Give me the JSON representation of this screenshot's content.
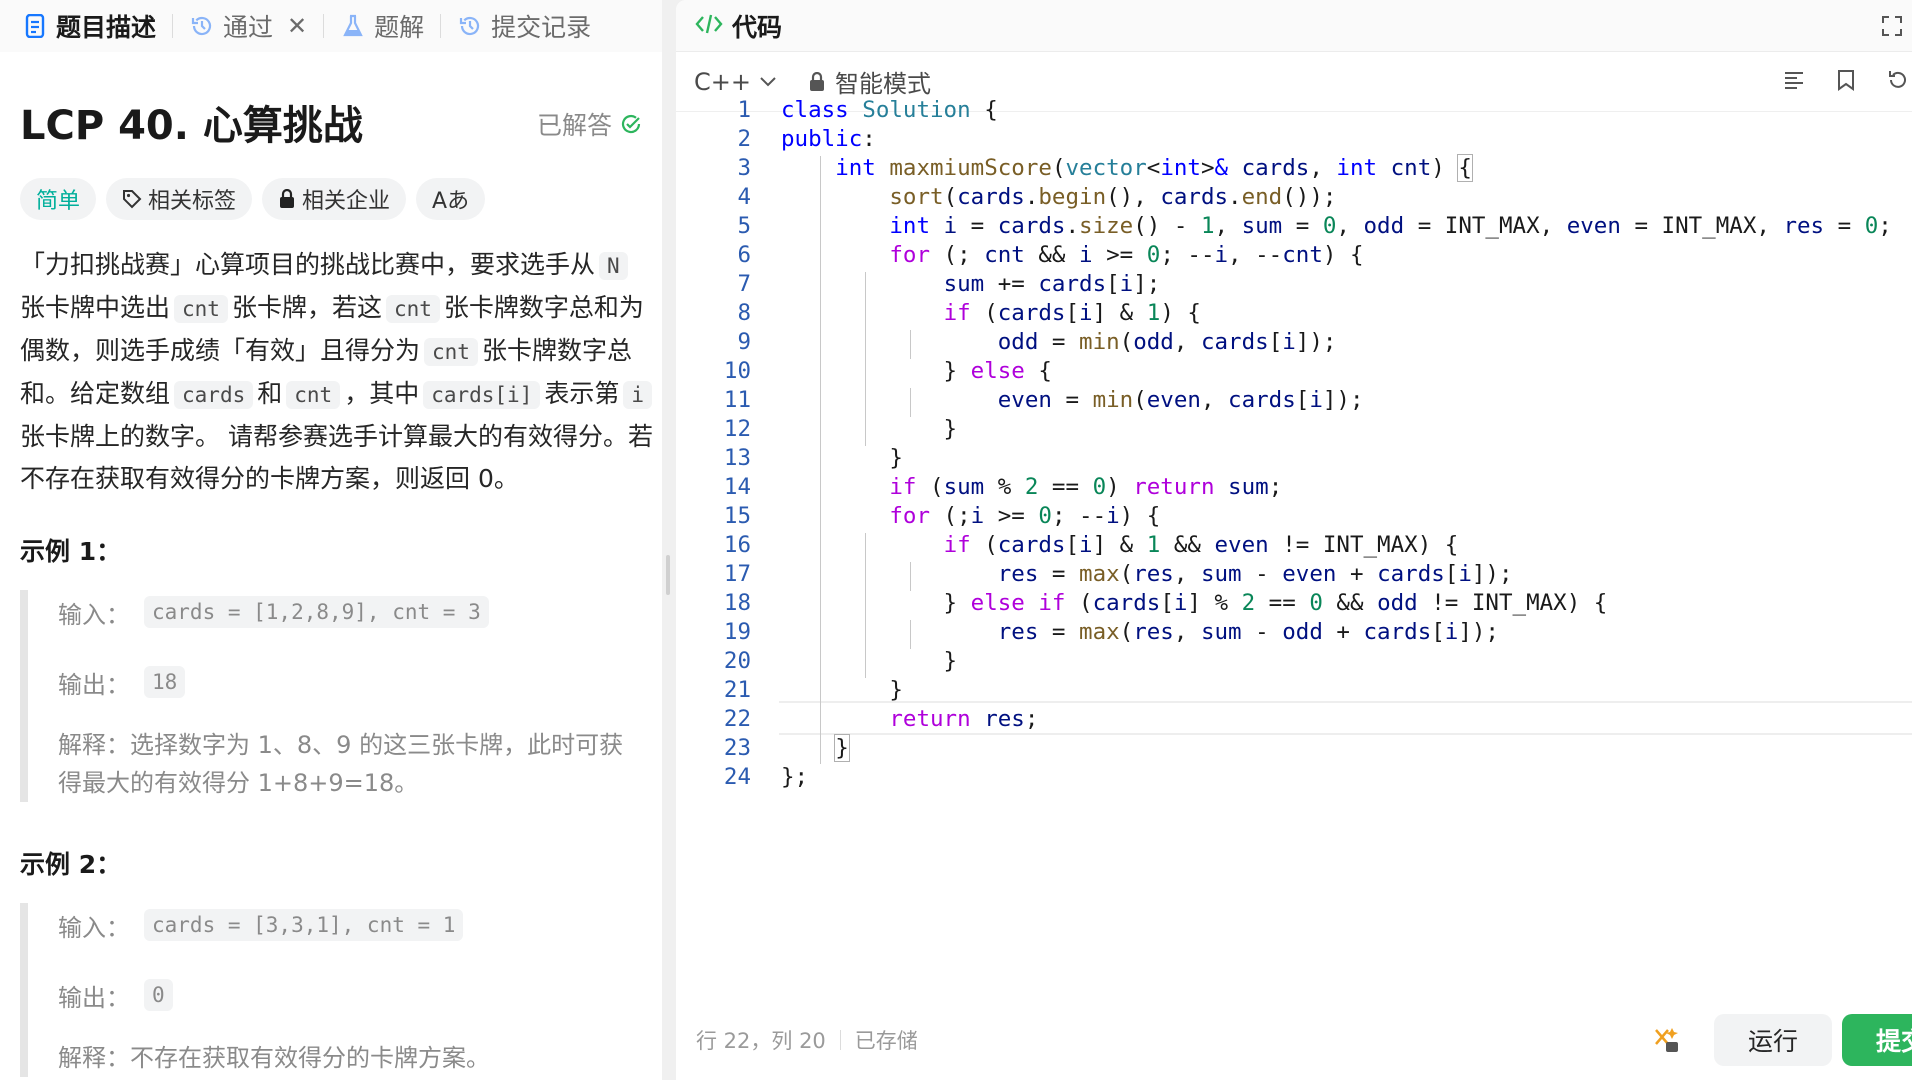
{
  "left_tabs": [
    {
      "label": "题目描述"
    },
    {
      "label": "通过"
    },
    {
      "label": "题解"
    },
    {
      "label": "提交记录"
    }
  ],
  "problem": {
    "title": "LCP 40. 心算挑战",
    "status": "已解答",
    "difficulty": "简单",
    "tags_label": "相关标签",
    "company_label": "相关企业",
    "font_toggle": "Aあ",
    "desc": {
      "p1": "「力扣挑战赛」心算项目的挑战比赛中，要求选手从",
      "c_N": "N",
      "p2": "张卡牌中选出",
      "c_cnt1": "cnt",
      "p3": "张卡牌，若这",
      "c_cnt2": "cnt",
      "p4": "张卡牌数字总和为偶数，则选手成绩「有效」且得分为",
      "c_cnt3": "cnt",
      "p5": "张卡牌数字总和。给定数组",
      "c_cards": "cards",
      "p6": "和",
      "c_cnt4": "cnt",
      "p7": "，其中",
      "c_cardsi": "cards[i]",
      "p8": "表示第",
      "c_i": "i",
      "p9": "张卡牌上的数字。 请帮参赛选手计算最大的有效得分。若不存在获取有效得分的卡牌方案，则返回 0。"
    },
    "examples": [
      {
        "heading": "示例 1：",
        "input_label": "输入：",
        "input": "cards = [1,2,8,9], cnt = 3",
        "output_label": "输出：",
        "output": "18",
        "explain_label": "解释：",
        "explain": "选择数字为 1、8、9 的这三张卡牌，此时可获得最大的有效得分 1+8+9=18。"
      },
      {
        "heading": "示例 2：",
        "input_label": "输入：",
        "input": "cards = [3,3,1], cnt = 1",
        "output_label": "输出：",
        "output": "0",
        "explain_label": "解释：",
        "explain": "不存在获取有效得分的卡牌方案。"
      }
    ]
  },
  "editor": {
    "header_title": "代码",
    "language": "C++",
    "mode": "智能模式",
    "line_numbers": [
      "1",
      "2",
      "3",
      "4",
      "5",
      "6",
      "7",
      "8",
      "9",
      "10",
      "11",
      "12",
      "13",
      "14",
      "15",
      "16",
      "17",
      "18",
      "19",
      "20",
      "21",
      "22",
      "23",
      "24"
    ],
    "status_pos": "行 22，列 20",
    "status_saved": "已存储",
    "run_label": "运行",
    "submit_label": "提交"
  },
  "colors": {
    "accent_green": "#2db55d",
    "easy": "#00af9b",
    "keyword": "#0000ff",
    "number": "#098658",
    "function": "#795e26",
    "control": "#af00db"
  }
}
